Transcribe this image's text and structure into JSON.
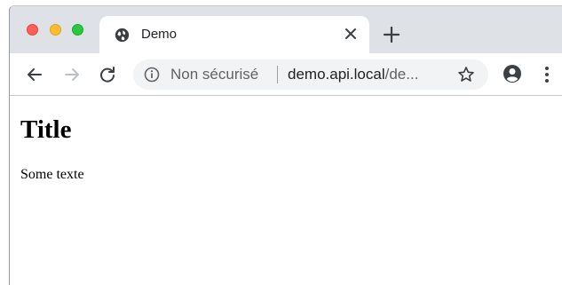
{
  "window": {
    "controls": [
      "close",
      "minimize",
      "zoom"
    ]
  },
  "tab": {
    "title": "Demo",
    "favicon": "globe-icon",
    "close_icon": "close-icon"
  },
  "new_tab_icon": "plus-icon",
  "toolbar": {
    "back_icon": "arrow-left-icon",
    "forward_icon": "arrow-right-icon",
    "reload_icon": "reload-icon",
    "security_icon": "info-icon",
    "security_label": "Non sécurisé",
    "url_host": "demo.api.local",
    "url_rest": "/de...",
    "bookmark_icon": "star-icon",
    "profile_icon": "account-icon",
    "menu_icon": "kebab-menu-icon"
  },
  "page": {
    "heading": "Title",
    "text": "Some texte"
  },
  "colors": {
    "tabstrip_bg": "#dee1e6",
    "omnibox_bg": "#f1f3f4",
    "close_red": "#fe5f57",
    "minimize_yellow": "#febc2e",
    "zoom_green": "#28c840"
  }
}
